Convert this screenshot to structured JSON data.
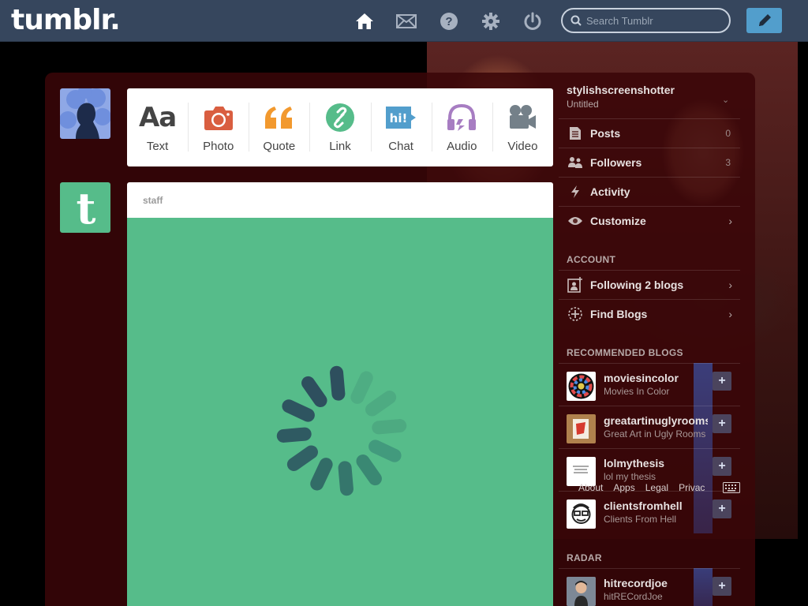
{
  "header": {
    "logo": "tumblr.",
    "search_placeholder": "Search Tumblr",
    "nav": [
      "home-icon",
      "mail-icon",
      "help-icon",
      "settings-icon",
      "power-icon"
    ],
    "compose": "pencil-icon"
  },
  "post_types": [
    {
      "label": "Text",
      "icon": "text-icon",
      "color": "#444444"
    },
    {
      "label": "Photo",
      "icon": "camera-icon",
      "color": "#d95e40"
    },
    {
      "label": "Quote",
      "icon": "quote-icon",
      "color": "#f2992e"
    },
    {
      "label": "Link",
      "icon": "link-icon",
      "color": "#56bc8a"
    },
    {
      "label": "Chat",
      "icon": "chat-icon",
      "color": "#529ecc"
    },
    {
      "label": "Audio",
      "icon": "headphones-icon",
      "color": "#a77dc2"
    },
    {
      "label": "Video",
      "icon": "video-camera-icon",
      "color": "#748089"
    }
  ],
  "post": {
    "author": "staff",
    "media_color": "#56bc8a",
    "loading": true
  },
  "sidebar": {
    "blog_name": "stylishscreenshotter",
    "blog_title": "Untitled",
    "menu": [
      {
        "label": "Posts",
        "icon": "posts-icon",
        "count": "0"
      },
      {
        "label": "Followers",
        "icon": "followers-icon",
        "count": "3"
      },
      {
        "label": "Activity",
        "icon": "lightning-icon"
      },
      {
        "label": "Customize",
        "icon": "eye-icon",
        "chevron": true
      }
    ],
    "account_title": "ACCOUNT",
    "account": [
      {
        "label": "Following 2 blogs",
        "icon": "following-icon"
      },
      {
        "label": "Find Blogs",
        "icon": "find-blogs-icon"
      }
    ],
    "recommended_title": "RECOMMENDED BLOGS",
    "recommended": [
      {
        "name": "moviesincolor",
        "title": "Movies In Color"
      },
      {
        "name": "greatartinuglyrooms",
        "title": "Great Art in Ugly Rooms"
      },
      {
        "name": "lolmythesis",
        "title": "lol my thesis"
      },
      {
        "name": "clientsfromhell",
        "title": "Clients From Hell"
      }
    ],
    "radar_title": "RADAR",
    "radar": [
      {
        "name": "hitrecordjoe",
        "title": "hitRECordJoe"
      }
    ]
  },
  "footer": {
    "links": [
      "About",
      "Apps",
      "Legal",
      "Privac"
    ]
  },
  "colors": {
    "header": "#36465d",
    "accent": "#529ecc"
  }
}
